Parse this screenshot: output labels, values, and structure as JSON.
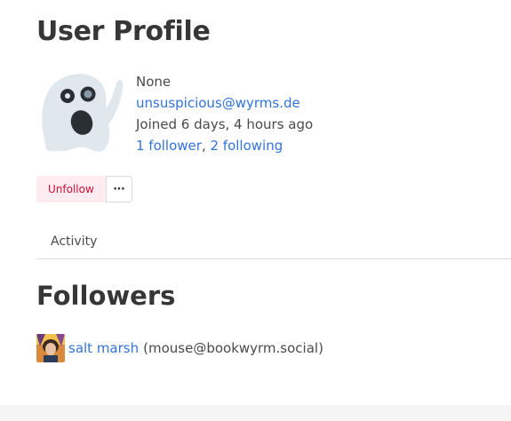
{
  "profile": {
    "page_title": "User Profile",
    "name": "None",
    "email": "unsuspicious@wyrms.de",
    "joined": "Joined 6 days, 4 hours ago",
    "followers_link": "1 follower",
    "separator": ", ",
    "following_link": "2 following",
    "avatar_icon": "ghost-icon"
  },
  "actions": {
    "unfollow_label": "Unfollow",
    "more_label": "···",
    "more_icon": "ellipsis-icon"
  },
  "tabs": [
    {
      "label": "Activity"
    }
  ],
  "followers_section": {
    "title": "Followers",
    "items": [
      {
        "name": "salt marsh",
        "handle": "(mouse@bookwyrm.social)"
      }
    ]
  },
  "colors": {
    "link": "#3273dc",
    "danger_text": "#cc0f35",
    "danger_bg": "#feecf0",
    "text": "#363636"
  }
}
